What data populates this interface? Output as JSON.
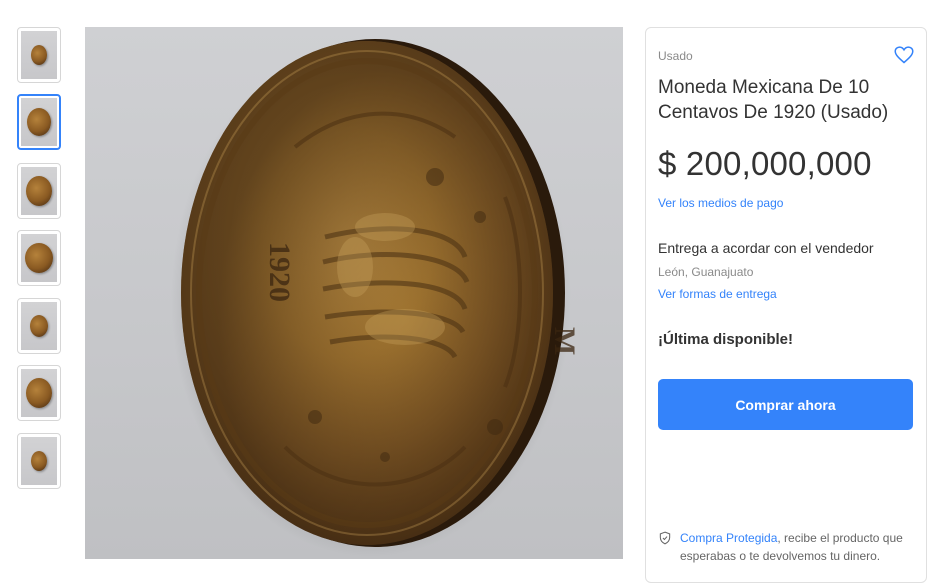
{
  "gallery": {
    "thumbnails": [
      {
        "label": "thumbnail-1"
      },
      {
        "label": "thumbnail-2"
      },
      {
        "label": "thumbnail-3"
      },
      {
        "label": "thumbnail-4"
      },
      {
        "label": "thumbnail-5"
      },
      {
        "label": "thumbnail-6"
      },
      {
        "label": "thumbnail-7"
      }
    ],
    "selected_index": 1,
    "selected_border_color": "#3483fa"
  },
  "product": {
    "condition": "Usado",
    "title": "Moneda Mexicana De 10 Centavos De 1920 (Usado)",
    "price": "$ 200,000,000",
    "payment_link": "Ver los medios de pago",
    "delivery_text": "Entrega a acordar con el vendedor",
    "location": "León, Guanajuato",
    "delivery_link": "Ver formas de entrega",
    "stock_text": "¡Última disponible!",
    "buy_button": "Comprar ahora",
    "protection_link": "Compra Protegida",
    "protection_text": ", recibe el producto que esperabas o te devolvemos tu dinero."
  },
  "icons": {
    "favorite": "heart-icon",
    "protection": "shield-check-icon"
  },
  "colors": {
    "accent": "#3483fa",
    "text": "#333333",
    "muted": "#8a8a8a"
  }
}
